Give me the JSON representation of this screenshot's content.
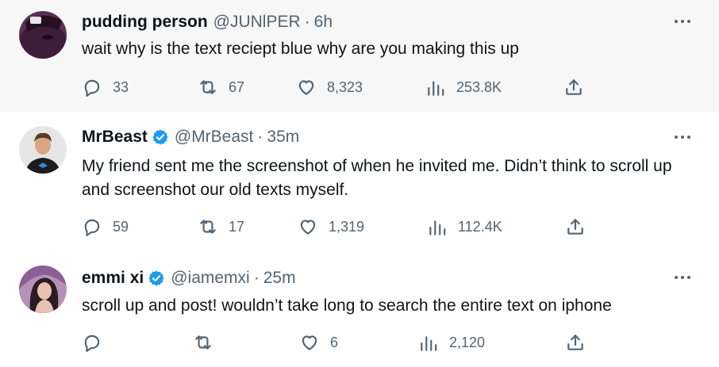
{
  "colors": {
    "text": "#0f1419",
    "muted": "#536471",
    "verified": "#1d9bf0",
    "thread_line": "#cfd9de",
    "highlight_bg": "#f7f7f7"
  },
  "tweets": [
    {
      "name": "pudding person",
      "handle": "@JUNlPER",
      "separator": "·",
      "time": "6h",
      "verified": false,
      "text": "wait why is the text reciept blue why are you making this up",
      "replies": "33",
      "retweets": "67",
      "likes": "8,323",
      "views": "253.8K"
    },
    {
      "name": "MrBeast",
      "handle": "@MrBeast",
      "separator": "·",
      "time": "35m",
      "verified": true,
      "text": "My friend sent me the screenshot of when he invited me. Didn’t think to scroll up and screenshot our old texts myself.",
      "replies": "59",
      "retweets": "17",
      "likes": "1,319",
      "views": "112.4K"
    },
    {
      "name": "emmi xi",
      "handle": "@iamemxi",
      "separator": "·",
      "time": "25m",
      "verified": true,
      "text": "scroll up and post! wouldn’t take long to search the entire text on iphone",
      "replies": "",
      "retweets": "",
      "likes": "6",
      "views": "2,120"
    }
  ]
}
